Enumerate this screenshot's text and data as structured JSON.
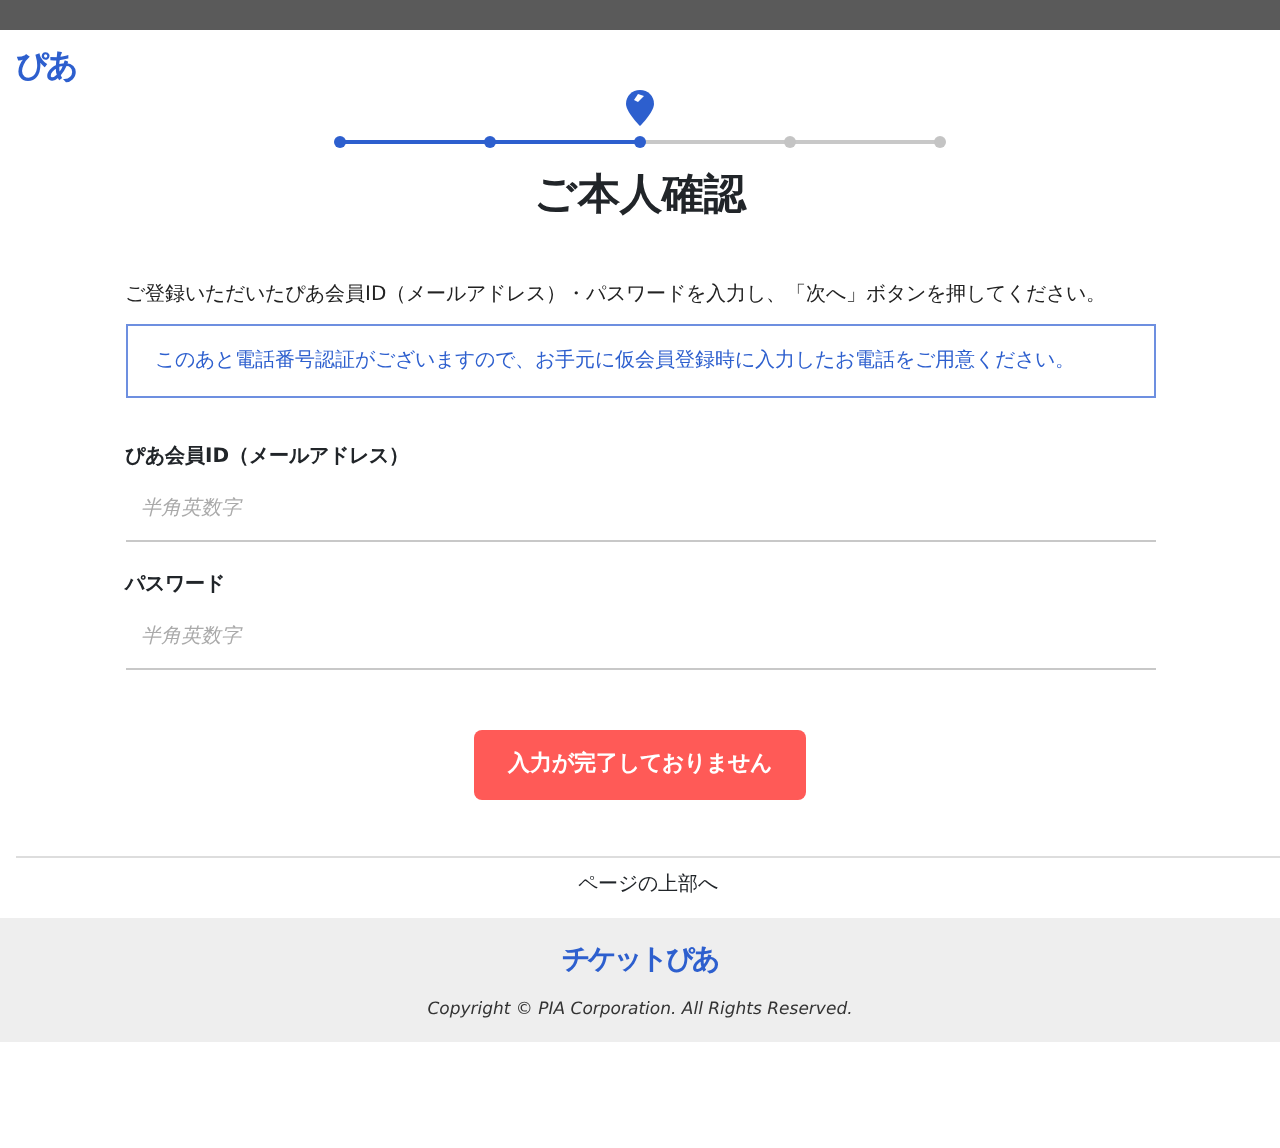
{
  "header": {
    "logo": "ぴあ"
  },
  "steps": [
    {
      "done": true,
      "selected": false
    },
    {
      "done": true,
      "selected": false
    },
    {
      "done": true,
      "selected": true
    },
    {
      "done": false,
      "selected": false
    },
    {
      "done": false,
      "selected": false
    }
  ],
  "title": "ご本人確認",
  "intro": "ご登録いただいたぴあ会員ID（メールアドレス）・パスワードを入力し、「次へ」ボタンを押してください。",
  "notice": "このあと電話番号認証がございますので、お手元に仮会員登録時に入力したお電話をご用意ください。",
  "fields": [
    {
      "label": "ぴあ会員ID（メールアドレス）",
      "placeholder": "半角英数字"
    },
    {
      "label": "パスワード",
      "placeholder": "半角英数字"
    }
  ],
  "submit": {
    "label": "入力が完了しておりません",
    "disabled": true
  },
  "back_to_top": "ページの上部へ",
  "footer": {
    "logo": "チケットぴあ",
    "copyright": "Copyright © PIA Corporation. All Rights Reserved."
  }
}
